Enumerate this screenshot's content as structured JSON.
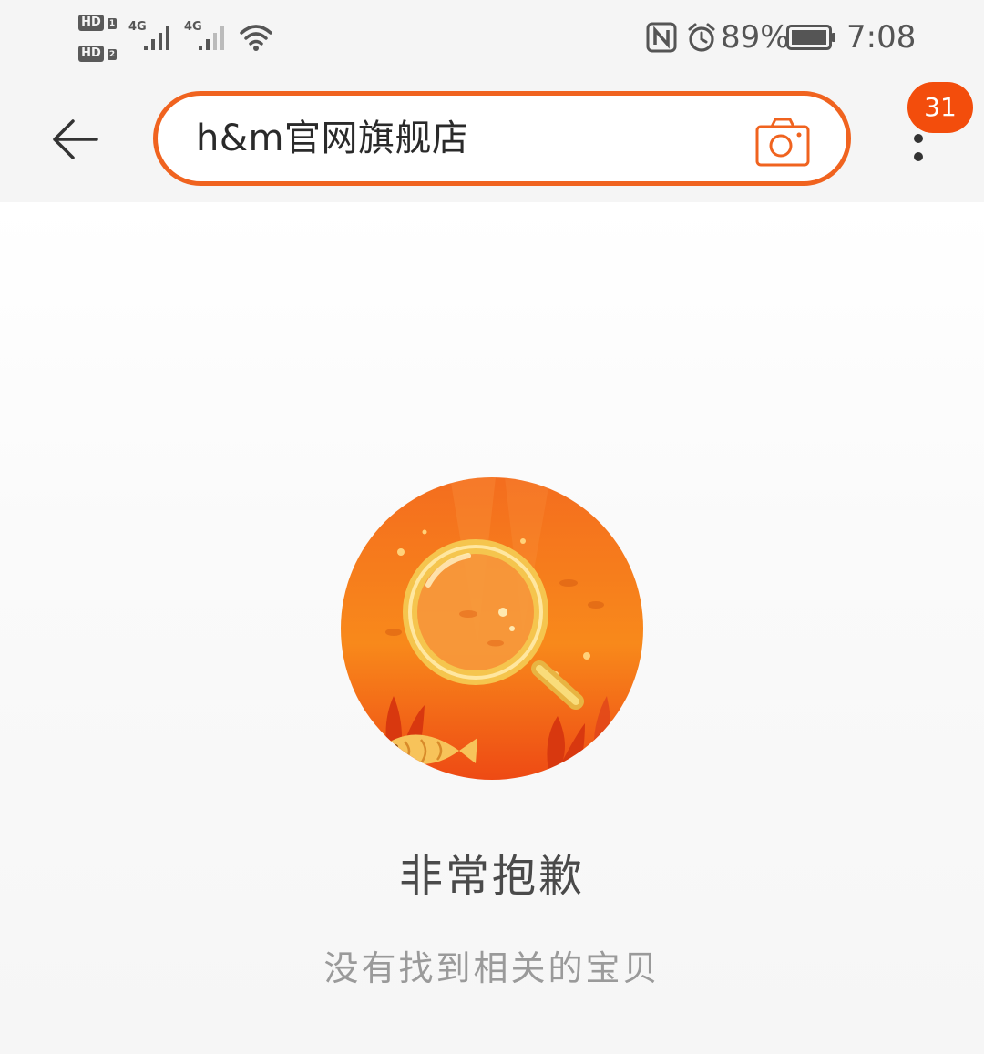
{
  "status_bar": {
    "sim1_hd": "HD",
    "sim1_index": "1",
    "sim2_hd": "HD",
    "sim2_index": "2",
    "network1": "4G",
    "network2": "4G",
    "battery": "89%",
    "time": "7:08",
    "icons": [
      "nfc-icon",
      "alarm-icon",
      "battery-icon",
      "wifi-icon",
      "signal-icon"
    ]
  },
  "search": {
    "query": "h&m官网旗舰店",
    "back_icon": "arrow-left-icon",
    "camera_icon": "camera-icon"
  },
  "menu": {
    "more_icon": "more-vertical-icon",
    "badge_count": "31"
  },
  "empty_state": {
    "illustration": "magnifier-underwater-illustration",
    "title": "非常抱歉",
    "subtitle": "没有找到相关的宝贝"
  },
  "colors": {
    "accent": "#f0631f",
    "badge": "#f34d0c",
    "text_primary": "#4a4a4a",
    "text_secondary": "#9a9a9a"
  }
}
